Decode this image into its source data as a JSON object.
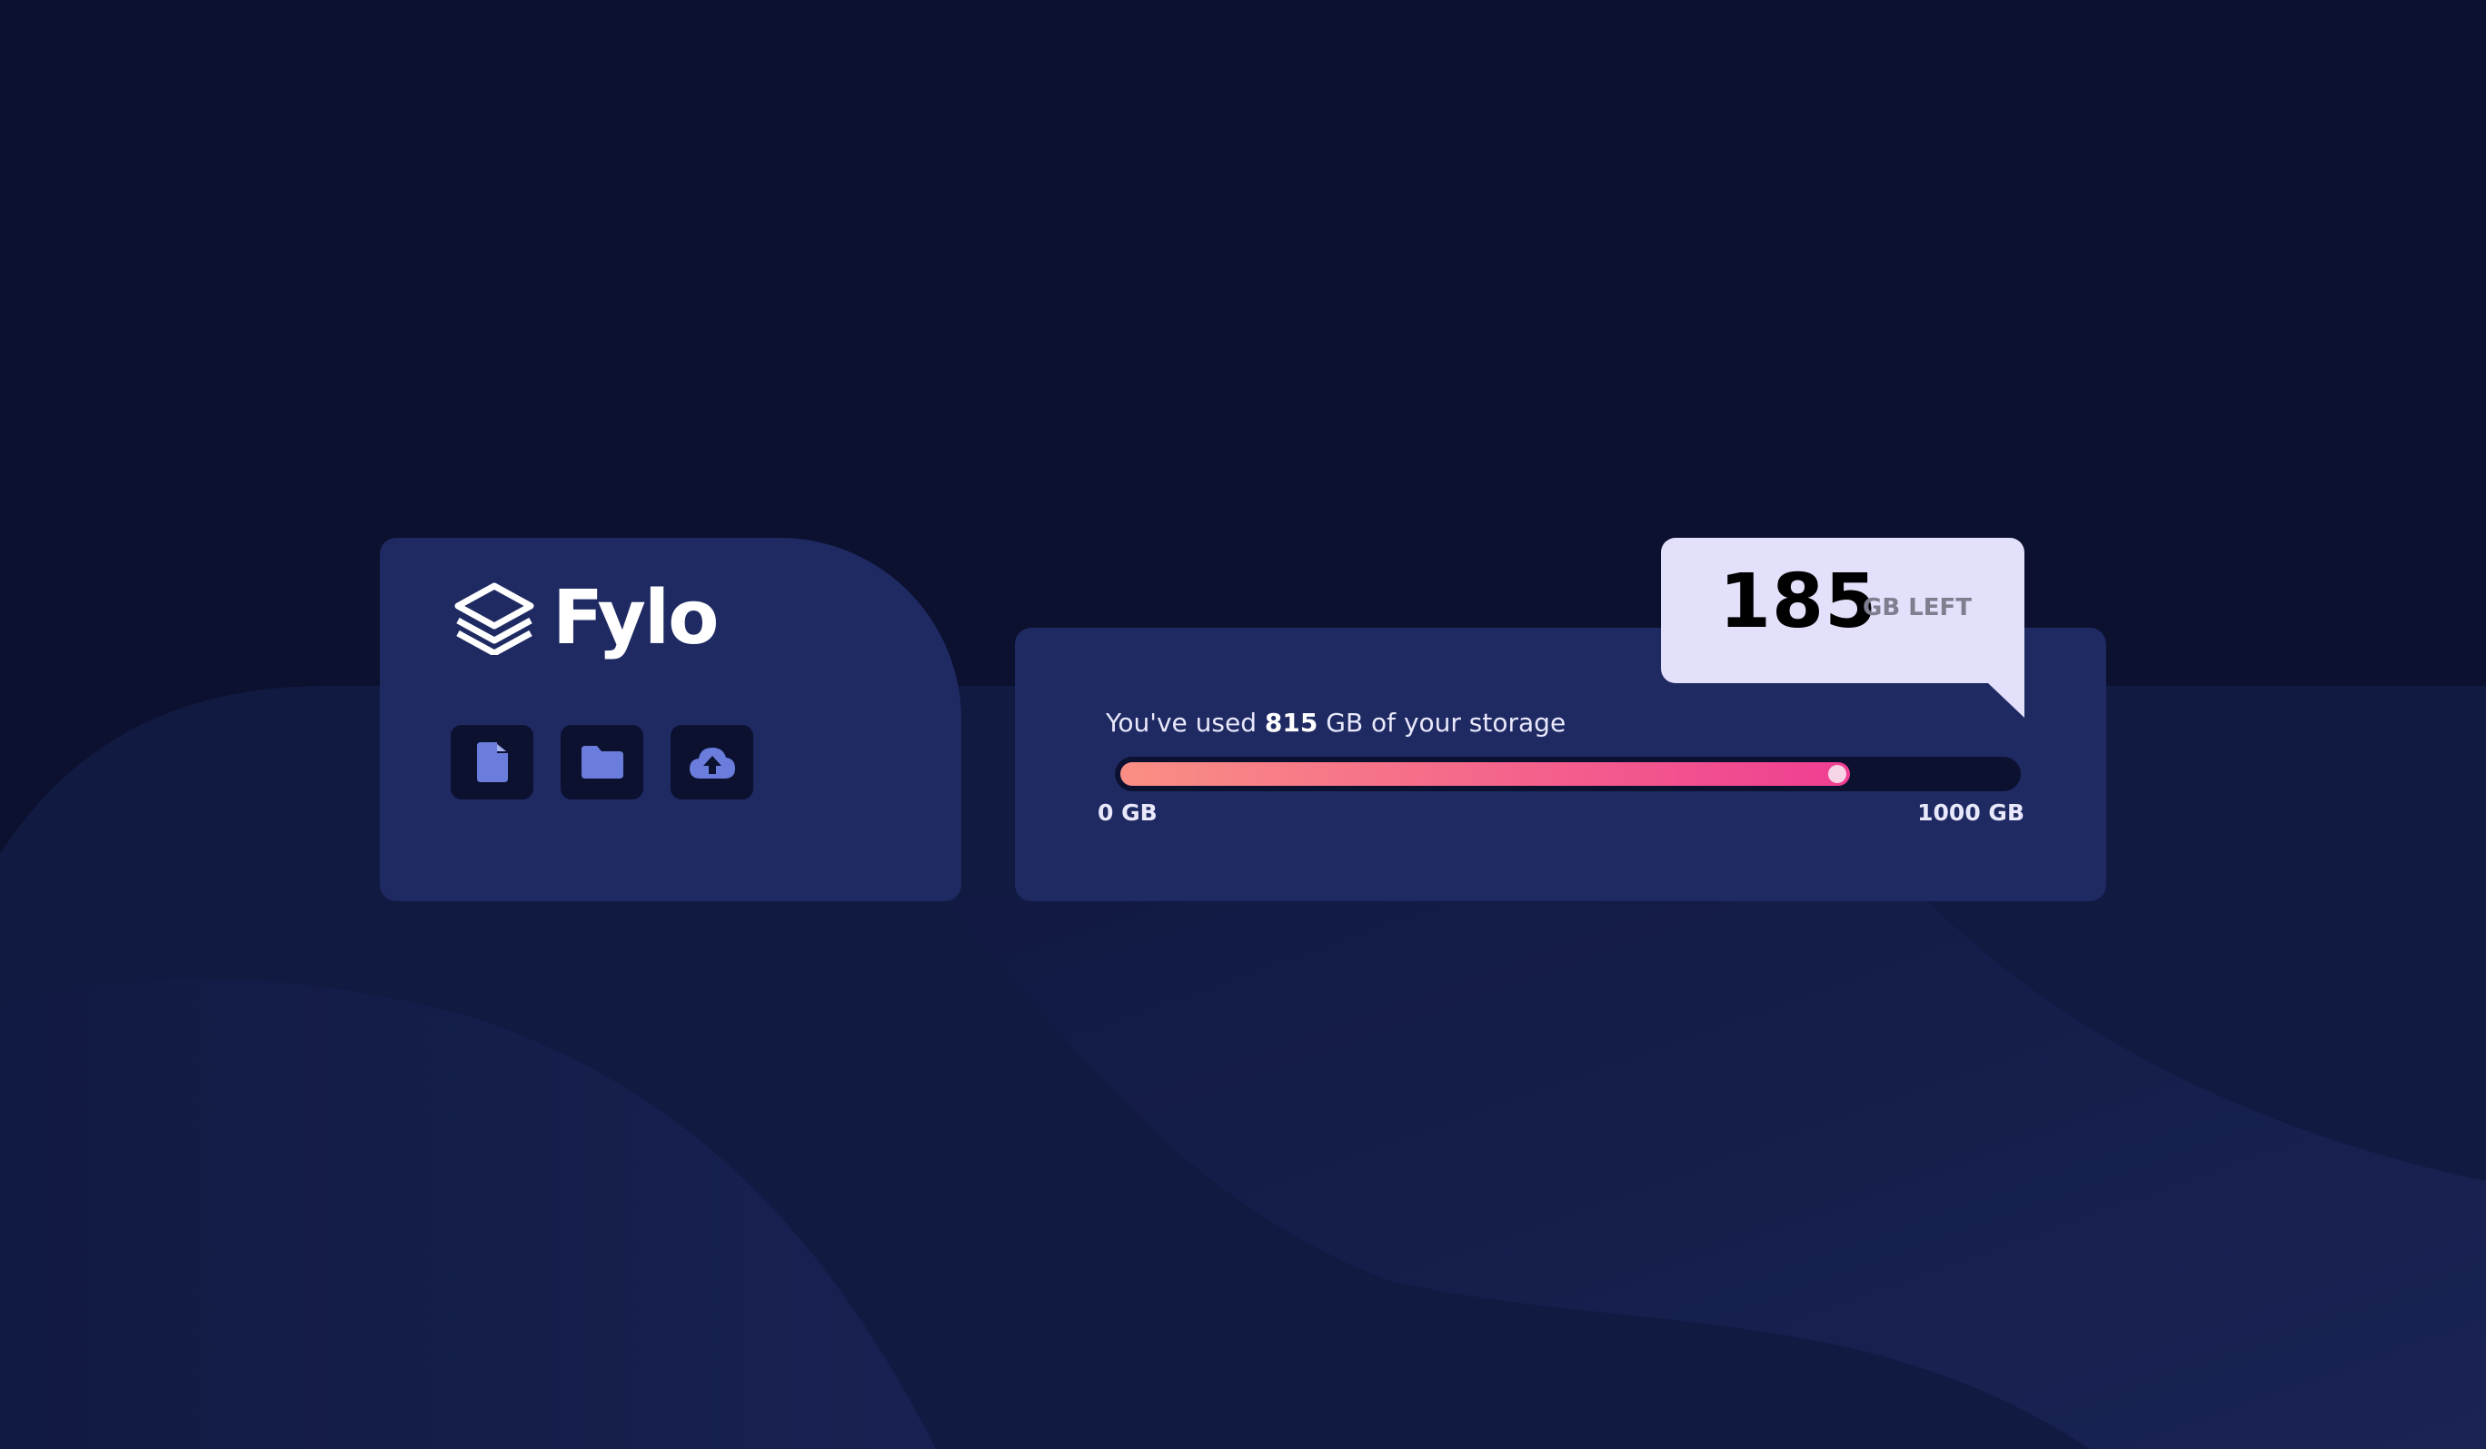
{
  "brand": {
    "name": "Fylo",
    "logo_icon": "layers-icon"
  },
  "tools": [
    {
      "name": "file-icon",
      "label": "document"
    },
    {
      "name": "folder-icon",
      "label": "folder"
    },
    {
      "name": "cloud-upload-icon",
      "label": "upload"
    }
  ],
  "storage": {
    "used_prefix": "You've used ",
    "used_value": "815",
    "used_suffix": " GB of your storage",
    "used_fraction": 0.815,
    "scale_min": "0 GB",
    "scale_max": "1000 GB"
  },
  "callout": {
    "remaining_value": "185",
    "remaining_unit": "GB LEFT"
  },
  "colors": {
    "page_background": "#0c1130",
    "card_background": "#1f2a63",
    "callout_background": "#e2e0fb",
    "meter_gradient_start": "#fa8f84",
    "meter_gradient_end": "#ef3e92",
    "icon_accent": "#6a7ddc"
  }
}
